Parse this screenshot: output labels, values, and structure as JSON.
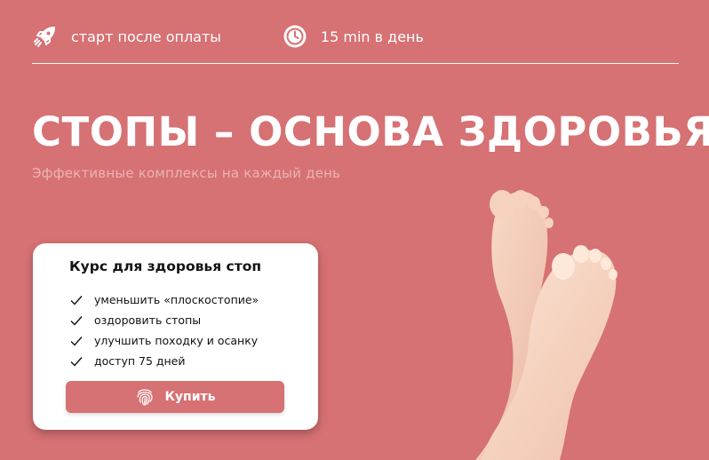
{
  "topbar": {
    "items": [
      {
        "icon": "rocket-icon",
        "label": "старт после оплаты"
      },
      {
        "icon": "clock-icon",
        "label": "15 min в день"
      }
    ]
  },
  "hero": {
    "title": "СТОПЫ – ОСНОВА ЗДОРОВЬЯ",
    "subtitle": "Эффективные комплексы на каждый день"
  },
  "card": {
    "title": "Курс для здоровья стоп",
    "items": [
      "уменьшить «плоскостопие»",
      "оздоровить стопы",
      "улучшить походку и осанку",
      "доступ 75 дней"
    ],
    "button_label": "Купить",
    "button_icon": "fingerprint-icon"
  },
  "colors": {
    "background": "#d67174",
    "card": "#ffffff",
    "subtitle": "#ecb3b5"
  }
}
